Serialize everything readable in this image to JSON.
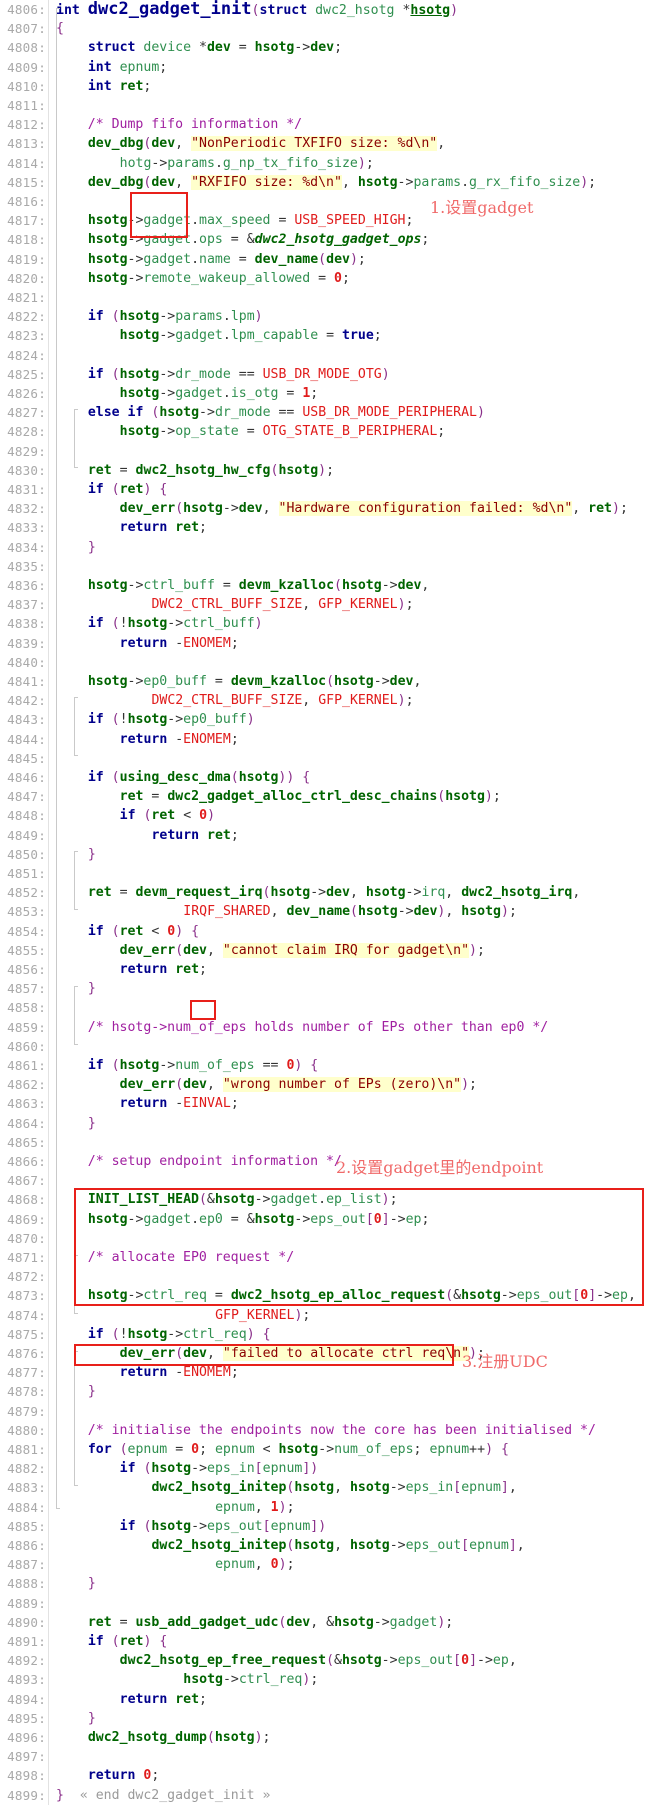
{
  "view": {
    "title": "dwc2_gadget_init",
    "first_line": 4806,
    "last_line": 4899,
    "fold_end_label": "« end dwc2_gadget_init »"
  },
  "colors": {
    "background": "#ffffff",
    "line_number": "#a9a9a9",
    "keyword": "#00008b",
    "function": "#006400",
    "string_fg": "#8b0000",
    "string_bg": "#ffffcc",
    "comment": "#a020a0",
    "constant": "#e01b1b",
    "punctuation": "#8a2f8a",
    "annotation_red": "#e8201a",
    "annotation_text": "#f06a6a"
  },
  "annotations": [
    {
      "id": "note-1",
      "text": "1.设置gadget",
      "target": "gadget member assignments (lines 4817-4819)"
    },
    {
      "id": "note-2",
      "text": "2.设置gadget里的endpoint",
      "target": "endpoint init loop (lines 4880-4888)"
    },
    {
      "id": "note-3",
      "text": "3.注册UDC",
      "target": "usb_add_gadget_udc call (line 4890)"
    }
  ],
  "lines": [
    {
      "n": 4806,
      "text": "int dwc2_gadget_init(struct dwc2_hsotg *hsotg)"
    },
    {
      "n": 4807,
      "text": "{"
    },
    {
      "n": 4808,
      "text": "\tstruct device *dev = hsotg->dev;"
    },
    {
      "n": 4809,
      "text": "\tint epnum;"
    },
    {
      "n": 4810,
      "text": "\tint ret;"
    },
    {
      "n": 4811,
      "text": ""
    },
    {
      "n": 4812,
      "text": "\t/* Dump fifo information */"
    },
    {
      "n": 4813,
      "text": "\tdev_dbg(dev, \"NonPeriodic TXFIFO size: %d\\n\","
    },
    {
      "n": 4814,
      "text": "\t\thotg->params.g_np_tx_fifo_size);"
    },
    {
      "n": 4815,
      "text": "\tdev_dbg(dev, \"RXFIFO size: %d\\n\", hsotg->params.g_rx_fifo_size);"
    },
    {
      "n": 4816,
      "text": ""
    },
    {
      "n": 4817,
      "text": "\thsotg->gadget.max_speed = USB_SPEED_HIGH;"
    },
    {
      "n": 4818,
      "text": "\thsotg->gadget.ops = &dwc2_hsotg_gadget_ops;"
    },
    {
      "n": 4819,
      "text": "\thsotg->gadget.name = dev_name(dev);"
    },
    {
      "n": 4820,
      "text": "\thsotg->remote_wakeup_allowed = 0;"
    },
    {
      "n": 4821,
      "text": ""
    },
    {
      "n": 4822,
      "text": "\tif (hsotg->params.lpm)"
    },
    {
      "n": 4823,
      "text": "\t\thsotg->gadget.lpm_capable = true;"
    },
    {
      "n": 4824,
      "text": ""
    },
    {
      "n": 4825,
      "text": "\tif (hsotg->dr_mode == USB_DR_MODE_OTG)"
    },
    {
      "n": 4826,
      "text": "\t\thsotg->gadget.is_otg = 1;"
    },
    {
      "n": 4827,
      "text": "\telse if (hsotg->dr_mode == USB_DR_MODE_PERIPHERAL)"
    },
    {
      "n": 4828,
      "text": "\t\thsotg->op_state = OTG_STATE_B_PERIPHERAL;"
    },
    {
      "n": 4829,
      "text": ""
    },
    {
      "n": 4830,
      "text": "\tret = dwc2_hsotg_hw_cfg(hsotg);"
    },
    {
      "n": 4831,
      "text": "\tif (ret) {"
    },
    {
      "n": 4832,
      "text": "\t\tdev_err(hsotg->dev, \"Hardware configuration failed: %d\\n\", ret);"
    },
    {
      "n": 4833,
      "text": "\t\treturn ret;"
    },
    {
      "n": 4834,
      "text": "\t}"
    },
    {
      "n": 4835,
      "text": ""
    },
    {
      "n": 4836,
      "text": "\thsotg->ctrl_buff = devm_kzalloc(hsotg->dev,"
    },
    {
      "n": 4837,
      "text": "\t\t\tDWC2_CTRL_BUFF_SIZE, GFP_KERNEL);"
    },
    {
      "n": 4838,
      "text": "\tif (!hsotg->ctrl_buff)"
    },
    {
      "n": 4839,
      "text": "\t\treturn -ENOMEM;"
    },
    {
      "n": 4840,
      "text": ""
    },
    {
      "n": 4841,
      "text": "\thsotg->ep0_buff = devm_kzalloc(hsotg->dev,"
    },
    {
      "n": 4842,
      "text": "\t\t\tDWC2_CTRL_BUFF_SIZE, GFP_KERNEL);"
    },
    {
      "n": 4843,
      "text": "\tif (!hsotg->ep0_buff)"
    },
    {
      "n": 4844,
      "text": "\t\treturn -ENOMEM;"
    },
    {
      "n": 4845,
      "text": ""
    },
    {
      "n": 4846,
      "text": "\tif (using_desc_dma(hsotg)) {"
    },
    {
      "n": 4847,
      "text": "\t\tret = dwc2_gadget_alloc_ctrl_desc_chains(hsotg);"
    },
    {
      "n": 4848,
      "text": "\t\tif (ret < 0)"
    },
    {
      "n": 4849,
      "text": "\t\t\treturn ret;"
    },
    {
      "n": 4850,
      "text": "\t}"
    },
    {
      "n": 4851,
      "text": ""
    },
    {
      "n": 4852,
      "text": "\tret = devm_request_irq(hsotg->dev, hsotg->irq, dwc2_hsotg_irq,"
    },
    {
      "n": 4853,
      "text": "\t\t\t\tIRQF_SHARED, dev_name(hsotg->dev), hsotg);"
    },
    {
      "n": 4854,
      "text": "\tif (ret < 0) {"
    },
    {
      "n": 4855,
      "text": "\t\tdev_err(dev, \"cannot claim IRQ for gadget\\n\");"
    },
    {
      "n": 4856,
      "text": "\t\treturn ret;"
    },
    {
      "n": 4857,
      "text": "\t}"
    },
    {
      "n": 4858,
      "text": ""
    },
    {
      "n": 4859,
      "text": "\t/* hsotg->num_of_eps holds number of EPs other than ep0 */"
    },
    {
      "n": 4860,
      "text": ""
    },
    {
      "n": 4861,
      "text": "\tif (hsotg->num_of_eps == 0) {"
    },
    {
      "n": 4862,
      "text": "\t\tdev_err(dev, \"wrong number of EPs (zero)\\n\");"
    },
    {
      "n": 4863,
      "text": "\t\treturn -EINVAL;"
    },
    {
      "n": 4864,
      "text": "\t}"
    },
    {
      "n": 4865,
      "text": ""
    },
    {
      "n": 4866,
      "text": "\t/* setup endpoint information */"
    },
    {
      "n": 4867,
      "text": ""
    },
    {
      "n": 4868,
      "text": "\tINIT_LIST_HEAD(&hsotg->gadget.ep_list);"
    },
    {
      "n": 4869,
      "text": "\thsotg->gadget.ep0 = &hsotg->eps_out[0]->ep;"
    },
    {
      "n": 4870,
      "text": ""
    },
    {
      "n": 4871,
      "text": "\t/* allocate EP0 request */"
    },
    {
      "n": 4872,
      "text": ""
    },
    {
      "n": 4873,
      "text": "\thsotg->ctrl_req = dwc2_hsotg_ep_alloc_request(&hsotg->eps_out[0]->ep,"
    },
    {
      "n": 4874,
      "text": "\t\t\t\t\tGFP_KERNEL);"
    },
    {
      "n": 4875,
      "text": "\tif (!hsotg->ctrl_req) {"
    },
    {
      "n": 4876,
      "text": "\t\tdev_err(dev, \"failed to allocate ctrl req\\n\");"
    },
    {
      "n": 4877,
      "text": "\t\treturn -ENOMEM;"
    },
    {
      "n": 4878,
      "text": "\t}"
    },
    {
      "n": 4879,
      "text": ""
    },
    {
      "n": 4880,
      "text": "\t/* initialise the endpoints now the core has been initialised */"
    },
    {
      "n": 4881,
      "text": "\tfor (epnum = 0; epnum < hsotg->num_of_eps; epnum++) {"
    },
    {
      "n": 4882,
      "text": "\t\tif (hsotg->eps_in[epnum])"
    },
    {
      "n": 4883,
      "text": "\t\t\tdwc2_hsotg_initep(hsotg, hsotg->eps_in[epnum],"
    },
    {
      "n": 4884,
      "text": "\t\t\t\t\tepnum, 1);"
    },
    {
      "n": 4885,
      "text": "\t\tif (hsotg->eps_out[epnum])"
    },
    {
      "n": 4886,
      "text": "\t\t\tdwc2_hsotg_initep(hsotg, hsotg->eps_out[epnum],"
    },
    {
      "n": 4887,
      "text": "\t\t\t\t\tepnum, 0);"
    },
    {
      "n": 4888,
      "text": "\t}"
    },
    {
      "n": 4889,
      "text": ""
    },
    {
      "n": 4890,
      "text": "\tret = usb_add_gadget_udc(dev, &hsotg->gadget);"
    },
    {
      "n": 4891,
      "text": "\tif (ret) {"
    },
    {
      "n": 4892,
      "text": "\t\tdwc2_hsotg_ep_free_request(&hsotg->eps_out[0]->ep,"
    },
    {
      "n": 4893,
      "text": "\t\t\t\thsotg->ctrl_req);"
    },
    {
      "n": 4894,
      "text": "\t\treturn ret;"
    },
    {
      "n": 4895,
      "text": "\t}"
    },
    {
      "n": 4896,
      "text": "\tdwc2_hsotg_dump(hsotg);"
    },
    {
      "n": 4897,
      "text": ""
    },
    {
      "n": 4898,
      "text": "\treturn 0;"
    },
    {
      "n": 4899,
      "text": "} « end dwc2_gadget_init »"
    }
  ]
}
